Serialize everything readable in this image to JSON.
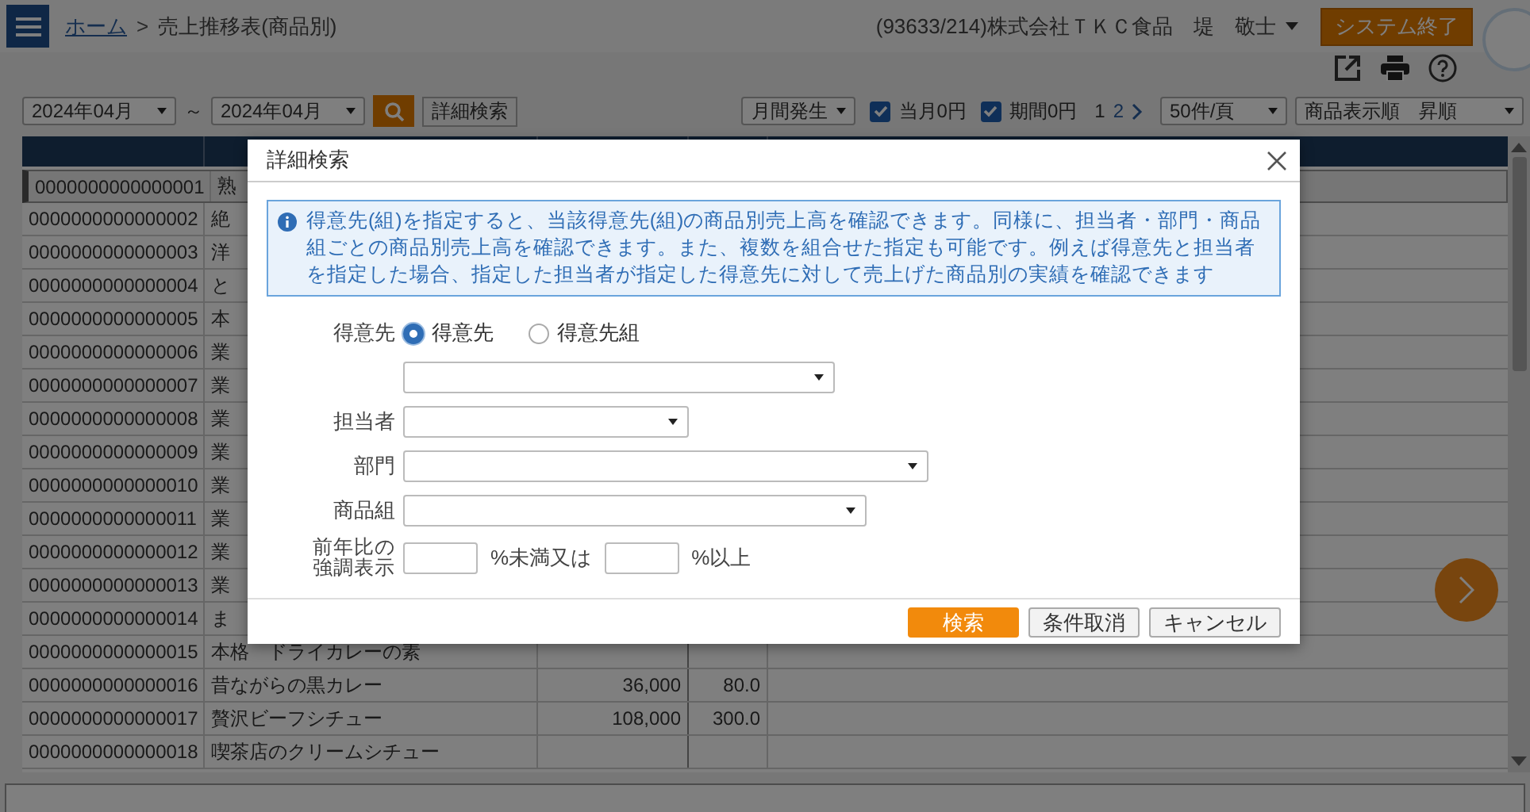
{
  "header": {
    "home_link": "ホーム",
    "separator": ">",
    "title": "売上推移表(商品別)",
    "user": "(93633/214)株式会社ＴＫＣ食品　堤　敬士",
    "exit_button": "システム終了"
  },
  "toolbar": {
    "from": "2024年04月",
    "tilde": "～",
    "to": "2024年04月",
    "detail_button": "詳細検索",
    "period": "月間発生",
    "checks": [
      {
        "label": "当月0円",
        "checked": true
      },
      {
        "label": "期間0円",
        "checked": true
      }
    ],
    "pages": [
      {
        "label": "1",
        "selected": true
      },
      {
        "label": "2",
        "selected": false
      }
    ],
    "per_page": "50件/頁",
    "sort": "商品表示順　昇順"
  },
  "table": {
    "rows": [
      {
        "code": "0000000000000001",
        "name": "熟",
        "selected": true
      },
      {
        "code": "0000000000000002",
        "name": "絶",
        "selected": false
      },
      {
        "code": "0000000000000003",
        "name": "洋",
        "selected": false
      },
      {
        "code": "0000000000000004",
        "name": "と",
        "selected": false
      },
      {
        "code": "0000000000000005",
        "name": "本",
        "selected": false
      },
      {
        "code": "0000000000000006",
        "name": "業",
        "selected": false
      },
      {
        "code": "0000000000000007",
        "name": "業",
        "selected": false
      },
      {
        "code": "0000000000000008",
        "name": "業",
        "selected": false
      },
      {
        "code": "0000000000000009",
        "name": "業",
        "selected": false
      },
      {
        "code": "0000000000000010",
        "name": "業",
        "selected": false
      },
      {
        "code": "0000000000000011",
        "name": "業",
        "selected": false
      },
      {
        "code": "0000000000000012",
        "name": "業",
        "selected": false
      },
      {
        "code": "0000000000000013",
        "name": "業",
        "selected": false
      },
      {
        "code": "0000000000000014",
        "name": "ま",
        "selected": false
      },
      {
        "code": "0000000000000015",
        "name": "本格　ドライカレーの素",
        "selected": false
      },
      {
        "code": "0000000000000016",
        "name": "昔ながらの黒カレー",
        "column_3": "36,000",
        "column_4": "80.0",
        "selected": false
      },
      {
        "code": "0000000000000017",
        "name": "贅沢ビーフシチュー",
        "column_3": "108,000",
        "column_4": "300.0",
        "selected": false
      },
      {
        "code": "0000000000000018",
        "name": "喫茶店のクリームシチュー",
        "selected": false
      }
    ]
  },
  "dialog": {
    "title": "詳細検索",
    "info": "得意先(組)を指定すると、当該得意先(組)の商品別売上高を確認できます。同様に、担当者・部門・商品組ごとの商品別売上高を確認できます。また、複数を組合せた指定も可能です。例えば得意先と担当者を指定した場合、指定した担当者が指定した得意先に対して売上げた商品別の実績を確認できます",
    "customer": {
      "label": "得意先",
      "options": [
        {
          "label": "得意先",
          "selected": true
        },
        {
          "label": "得意先組",
          "selected": false
        }
      ]
    },
    "selects": [
      {
        "label": "担当者"
      },
      {
        "label": "部門"
      },
      {
        "label": "商品組"
      }
    ],
    "ratio": {
      "label": "前年比の強調表示",
      "below": "%未満又は",
      "above": "%以上"
    },
    "buttons": [
      {
        "label": "検索",
        "kind": "primary"
      },
      {
        "label": "条件取消",
        "kind": "default"
      },
      {
        "label": "キャンセル",
        "kind": "default"
      }
    ]
  }
}
